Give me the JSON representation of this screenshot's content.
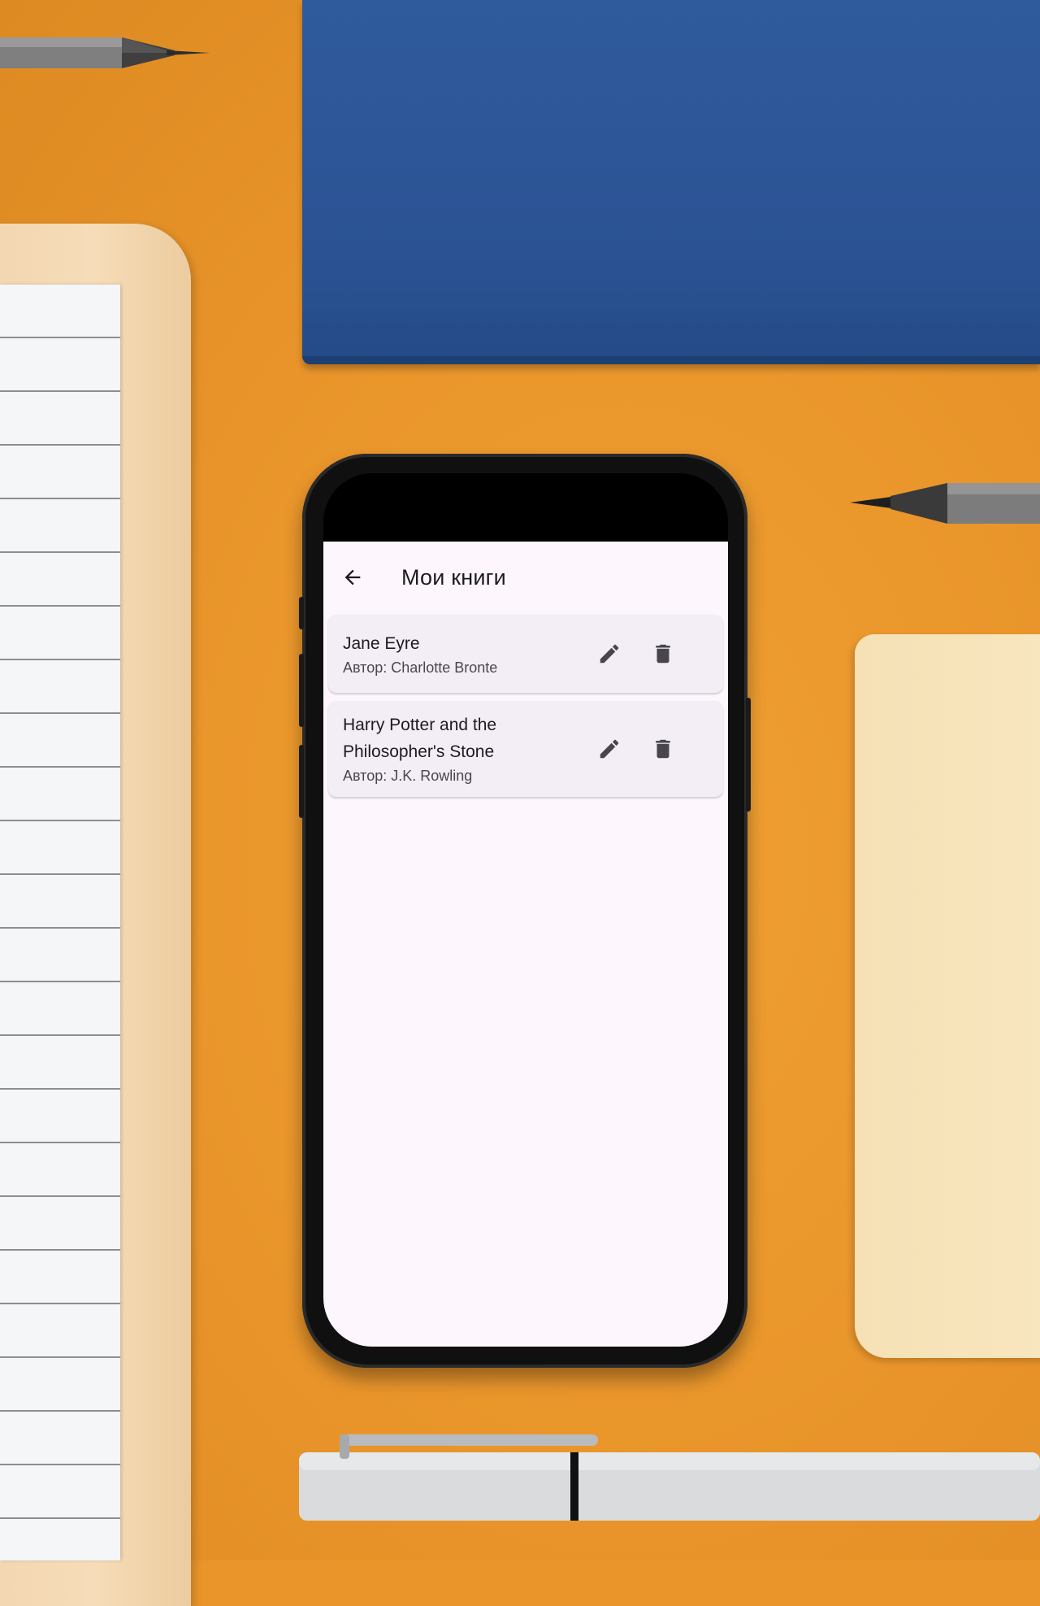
{
  "app": {
    "title": "Мои книги",
    "back_icon": "arrow-left-icon"
  },
  "books": [
    {
      "title": "Jane Eyre",
      "author": "Автор: Charlotte Bronte",
      "edit_icon": "pencil-icon",
      "delete_icon": "trash-icon"
    },
    {
      "title": "Harry Potter and the Philosopher's Stone",
      "author": "Автор: J.K. Rowling",
      "edit_icon": "pencil-icon",
      "delete_icon": "trash-icon"
    }
  ],
  "colors": {
    "app_background": "#fdf7fd",
    "card_background": "#f3eef5",
    "text_primary": "#1d1b20",
    "text_secondary": "#4a4550",
    "icon": "#49454f"
  }
}
